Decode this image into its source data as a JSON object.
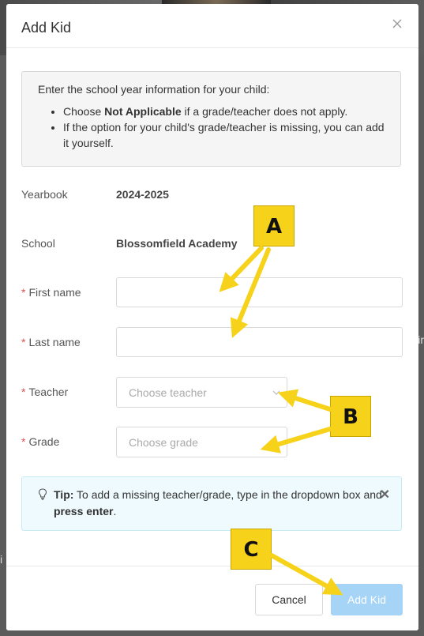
{
  "modal": {
    "title": "Add Kid"
  },
  "info": {
    "intro": "Enter the school year information for your child:",
    "bullet1_prefix": "Choose ",
    "bullet1_bold": "Not Applicable",
    "bullet1_suffix": " if a grade/teacher does not apply.",
    "bullet2": "If the option for your child's grade/teacher is missing, you can add it yourself."
  },
  "form": {
    "yearbook_label": "Yearbook",
    "yearbook_value": "2024-2025",
    "school_label": "School",
    "school_value": "Blossomfield Academy",
    "required_mark": "*",
    "first_name_label": "First name",
    "first_name_value": "",
    "last_name_label": "Last name",
    "last_name_value": "",
    "teacher_label": "Teacher",
    "teacher_placeholder": "Choose teacher",
    "grade_label": "Grade",
    "grade_placeholder": "Choose grade"
  },
  "tip": {
    "label": "Tip:",
    "text": " To add a missing teacher/grade, type in the dropdown box and ",
    "bold_end": "press enter",
    "end": ".",
    "close": "✕"
  },
  "footer": {
    "cancel_label": "Cancel",
    "add_label": "Add Kid"
  },
  "callouts": {
    "a": "A",
    "b": "B",
    "c": "C"
  },
  "colors": {
    "accent_disabled": "#a6d4f7",
    "required": "#e05050",
    "callout_fill": "#f7d21a",
    "tip_background": "#eefafd"
  }
}
